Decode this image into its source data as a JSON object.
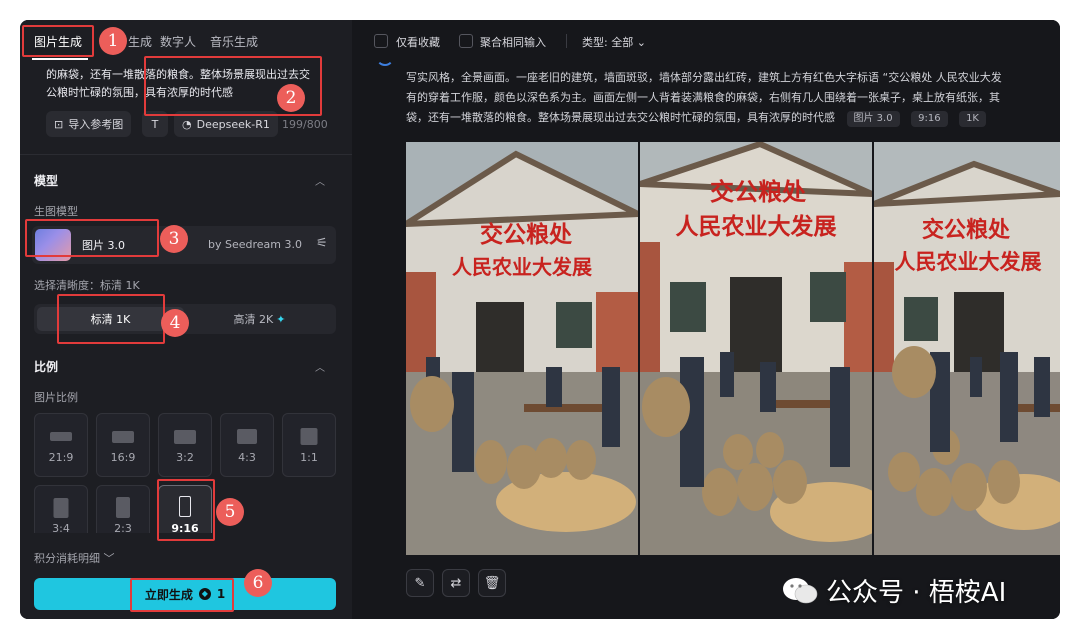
{
  "tabs": [
    {
      "label": "图片生成",
      "active": true
    },
    {
      "label": "生成"
    },
    {
      "label": "数字人"
    },
    {
      "label": "音乐生成"
    }
  ],
  "prompt": {
    "visible_text": "的麻袋，还有一堆散落的粮食。整体场景展现出过去交公粮时忙碌的氛围，具有浓厚的时代感",
    "ref_image_label": "导入参考图",
    "deepseek_label": "Deepseek-R1",
    "counter": "199/800"
  },
  "model_section": {
    "title": "模型",
    "model_label": "生图模型",
    "model_name": "图片 3.0",
    "model_by": "by Seedream 3.0"
  },
  "quality": {
    "label": "选择清晰度：标清 1K",
    "options": [
      {
        "label": "标清 1K",
        "selected": true
      },
      {
        "label": "高清 2K",
        "selected": false
      }
    ]
  },
  "ratio_section": {
    "title": "比例",
    "label": "图片比例",
    "ratios": [
      "21:9",
      "16:9",
      "3:2",
      "4:3",
      "1:1",
      "3:4",
      "2:3",
      "9:16"
    ],
    "selected": "9:16"
  },
  "credits_label": "积分消耗明细",
  "generate_label": "立即生成",
  "generate_cost": "1",
  "toolbar": {
    "favorites": "仅看收藏",
    "merge": "聚合相同输入",
    "type": "类型: 全部"
  },
  "result": {
    "desc_line1": "写实风格，全景画面。一座老旧的建筑，墙面斑驳，墙体部分露出红砖，建筑上方有红色大字标语 “交公粮处 人民农业大发",
    "desc_line2": "有的穿着工作服，颜色以深色系为主。画面左侧一人背着装满粮食的麻袋，右侧有几人围绕着一张桌子，桌上放有纸张，其",
    "desc_line3": "袋，还有一堆散落的粮食。整体场景展现出过去交公粮时忙碌的氛围，具有浓厚的时代感",
    "tags": [
      "图片 3.0",
      "9:16",
      "1K"
    ],
    "slogan_line1": "交公粮处",
    "slogan_line2": "人民农业大发展"
  },
  "badges": [
    "1",
    "2",
    "3",
    "4",
    "5",
    "6"
  ],
  "watermark": "公众号 · 梧桉AI",
  "colors": {
    "accent": "#1fc6e0",
    "highlight": "#e23b3b",
    "badge": "#ec5e5a",
    "slogan": "#c8231f"
  }
}
